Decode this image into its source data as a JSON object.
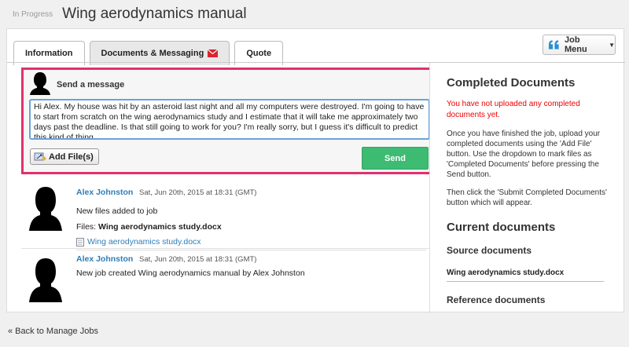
{
  "header": {
    "status": "In Progress",
    "title": "Wing aerodynamics manual"
  },
  "tabs": [
    {
      "label": "Information"
    },
    {
      "label": "Documents & Messaging"
    },
    {
      "label": "Quote"
    }
  ],
  "job_menu": {
    "label": "Job Menu"
  },
  "composer": {
    "heading": "Send a message",
    "message": "Hi Alex. My house was hit by an asteroid last night and all my computers were destroyed. I'm going to have to start from scratch on the wing aerodynamics study and I estimate that it will take me approximately two days past the deadline. Is that still going to work for you? I'm really sorry, but I guess it's difficult to predict this kind of thing...",
    "add_files_label": "Add File(s)",
    "send_label": "Send"
  },
  "messages": [
    {
      "author": "Alex Johnston",
      "time": "Sat, Jun 20th, 2015 at 18:31 (GMT)",
      "text": "New files added to job",
      "files_label": "Files:",
      "files_value": "Wing aerodynamics study.docx",
      "file_link": "Wing aerodynamics study.docx"
    },
    {
      "author": "Alex Johnston",
      "time": "Sat, Jun 20th, 2015 at 18:31 (GMT)",
      "text": "New job created Wing aerodynamics manual by Alex Johnston"
    }
  ],
  "sidebar": {
    "completed_heading": "Completed Documents",
    "warning": "You have not uploaded any completed documents yet.",
    "instructions_1": "Once you have finished the job, upload your completed documents using the 'Add File' button. Use the dropdown to mark files as 'Completed Documents' before pressing the Send button.",
    "instructions_2": "Then click the 'Submit Completed Documents' button which will appear.",
    "current_heading": "Current documents",
    "source_heading": "Source documents",
    "source_file": "Wing aerodynamics study.docx",
    "reference_heading": "Reference documents"
  },
  "footer": {
    "back_link": "« Back to Manage Jobs"
  },
  "colors": {
    "accent_pink": "#e0306d",
    "send_green": "#3dbb72",
    "link_blue": "#2f7eb7",
    "warning_red": "#e00000",
    "envelope_red": "#d9262f"
  },
  "icons": {
    "tab_mail": "envelope-icon",
    "job_menu": "quote-icon",
    "add_files": "attach-icon",
    "file": "document-icon"
  }
}
